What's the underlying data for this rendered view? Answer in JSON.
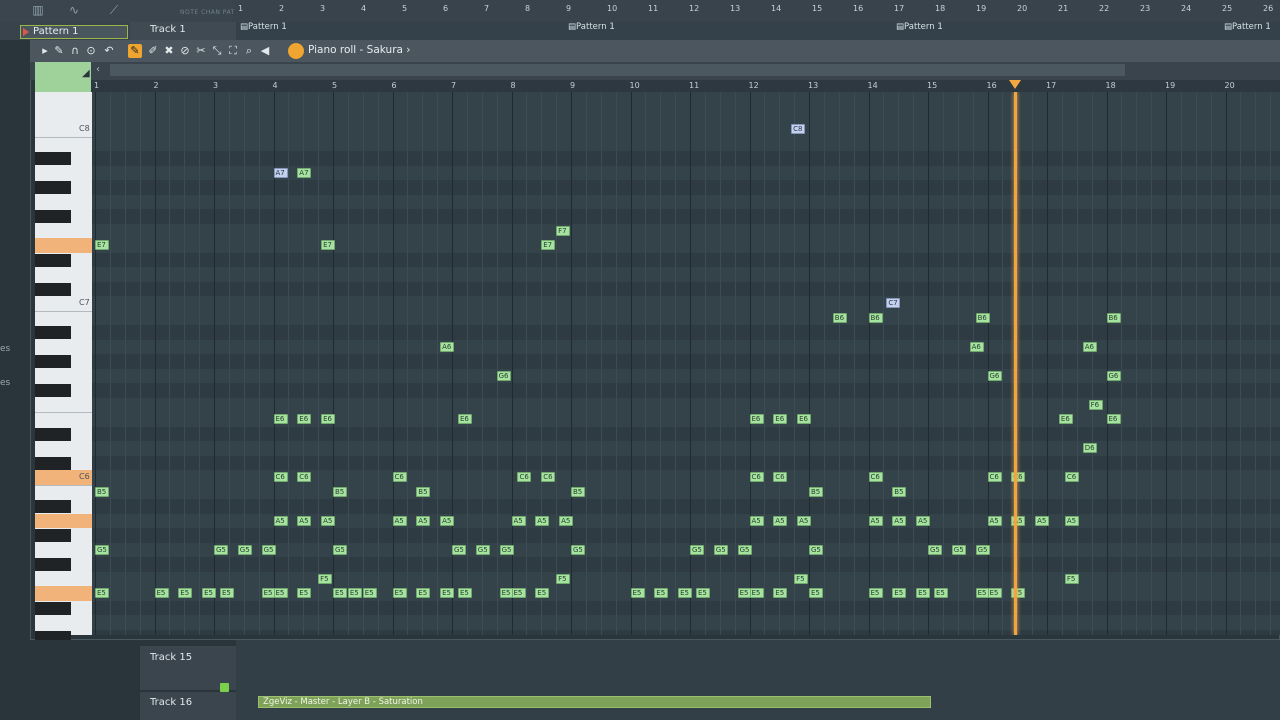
{
  "playlist": {
    "pattern_selector": "Pattern 1",
    "track1_name": "Track 1",
    "snap_label": "NOTE CHAN PAT",
    "ruler": [
      "1",
      "2",
      "3",
      "4",
      "5",
      "6",
      "7",
      "8",
      "9",
      "10",
      "11",
      "12",
      "13",
      "14",
      "15",
      "16",
      "17",
      "18",
      "19",
      "20",
      "21",
      "22",
      "23",
      "24",
      "25",
      "26"
    ],
    "patterns": [
      "Pattern 1",
      "Pattern 1",
      "Pattern 1",
      "Pattern 1",
      "Pattern 1"
    ],
    "tracks_bottom": [
      {
        "name": "Track 15"
      },
      {
        "name": "Track 16"
      }
    ],
    "automation_clip": "ZgeViz - Master - Layer B - Saturation",
    "left_edge_labels": [
      "es",
      "es"
    ]
  },
  "piano_roll": {
    "title": "Piano roll - Sakura",
    "title_arrow": "›",
    "ruler": [
      "1",
      "2",
      "3",
      "4",
      "5",
      "6",
      "7",
      "8",
      "9",
      "10",
      "11",
      "12",
      "13",
      "14",
      "15",
      "16",
      "17",
      "18",
      "19",
      "20"
    ],
    "octave_labels": [
      "C8",
      "C7",
      "C6"
    ],
    "playhead_bar": 16.45,
    "notes": [
      {
        "label": "C8",
        "bar": 12.7,
        "sel": true
      },
      {
        "label": "A7",
        "bar": 4.0,
        "sel": true
      },
      {
        "label": "A7",
        "bar": 4.4,
        "sel": false
      },
      {
        "label": "E7",
        "bar": 1.0,
        "sel": false
      },
      {
        "label": "E7",
        "bar": 4.8,
        "sel": false
      },
      {
        "label": "E7",
        "bar": 8.5,
        "sel": false
      },
      {
        "label": "F7",
        "bar": 8.75,
        "sel": false
      },
      {
        "label": "C7",
        "bar": 14.3,
        "sel": true
      },
      {
        "label": "B6",
        "bar": 13.4,
        "sel": false
      },
      {
        "label": "B6",
        "bar": 14.0,
        "sel": false
      },
      {
        "label": "B6",
        "bar": 15.8,
        "sel": false
      },
      {
        "label": "B6",
        "bar": 18.0,
        "sel": false
      },
      {
        "label": "A6",
        "bar": 6.8,
        "sel": false
      },
      {
        "label": "A6",
        "bar": 15.7,
        "sel": false
      },
      {
        "label": "A6",
        "bar": 17.6,
        "sel": false
      },
      {
        "label": "G6",
        "bar": 7.75,
        "sel": false
      },
      {
        "label": "G6",
        "bar": 16.0,
        "sel": false
      },
      {
        "label": "G6",
        "bar": 18.0,
        "sel": false
      },
      {
        "label": "F6",
        "bar": 17.7,
        "sel": false
      },
      {
        "label": "E6",
        "bar": 4.0,
        "sel": false
      },
      {
        "label": "E6",
        "bar": 4.4,
        "sel": false
      },
      {
        "label": "E6",
        "bar": 4.8,
        "sel": false
      },
      {
        "label": "E6",
        "bar": 7.1,
        "sel": false
      },
      {
        "label": "E6",
        "bar": 12.0,
        "sel": false
      },
      {
        "label": "E6",
        "bar": 12.4,
        "sel": false
      },
      {
        "label": "E6",
        "bar": 12.8,
        "sel": false
      },
      {
        "label": "E6",
        "bar": 17.2,
        "sel": false
      },
      {
        "label": "E6",
        "bar": 18.0,
        "sel": false
      },
      {
        "label": "D6",
        "bar": 17.6,
        "sel": false
      },
      {
        "label": "C6",
        "bar": 4.0,
        "sel": false
      },
      {
        "label": "C6",
        "bar": 4.4,
        "sel": false
      },
      {
        "label": "C6",
        "bar": 6.0,
        "sel": false
      },
      {
        "label": "C6",
        "bar": 8.1,
        "sel": false
      },
      {
        "label": "C6",
        "bar": 8.5,
        "sel": false
      },
      {
        "label": "C6",
        "bar": 12.0,
        "sel": false
      },
      {
        "label": "C6",
        "bar": 12.4,
        "sel": false
      },
      {
        "label": "C6",
        "bar": 14.0,
        "sel": false
      },
      {
        "label": "C6",
        "bar": 16.0,
        "sel": false
      },
      {
        "label": "C6",
        "bar": 16.4,
        "sel": false
      },
      {
        "label": "C6",
        "bar": 17.3,
        "sel": false
      },
      {
        "label": "B5",
        "bar": 1.0,
        "sel": false
      },
      {
        "label": "B5",
        "bar": 5.0,
        "sel": false
      },
      {
        "label": "B5",
        "bar": 6.4,
        "sel": false
      },
      {
        "label": "B5",
        "bar": 9.0,
        "sel": false
      },
      {
        "label": "B5",
        "bar": 13.0,
        "sel": false
      },
      {
        "label": "B5",
        "bar": 14.4,
        "sel": false
      },
      {
        "label": "A5",
        "bar": 4.0,
        "sel": false
      },
      {
        "label": "A5",
        "bar": 4.4,
        "sel": false
      },
      {
        "label": "A5",
        "bar": 4.8,
        "sel": false
      },
      {
        "label": "A5",
        "bar": 6.0,
        "sel": false
      },
      {
        "label": "A5",
        "bar": 6.4,
        "sel": false
      },
      {
        "label": "A5",
        "bar": 6.8,
        "sel": false
      },
      {
        "label": "A5",
        "bar": 8.0,
        "sel": false
      },
      {
        "label": "A5",
        "bar": 8.4,
        "sel": false
      },
      {
        "label": "A5",
        "bar": 8.8,
        "sel": false
      },
      {
        "label": "A5",
        "bar": 12.0,
        "sel": false
      },
      {
        "label": "A5",
        "bar": 12.4,
        "sel": false
      },
      {
        "label": "A5",
        "bar": 12.8,
        "sel": false
      },
      {
        "label": "A5",
        "bar": 14.0,
        "sel": false
      },
      {
        "label": "A5",
        "bar": 14.4,
        "sel": false
      },
      {
        "label": "A5",
        "bar": 14.8,
        "sel": false
      },
      {
        "label": "A5",
        "bar": 16.0,
        "sel": false
      },
      {
        "label": "A5",
        "bar": 16.4,
        "sel": false
      },
      {
        "label": "A5",
        "bar": 16.8,
        "sel": false
      },
      {
        "label": "A5",
        "bar": 17.3,
        "sel": false
      },
      {
        "label": "G5",
        "bar": 1.0,
        "sel": false
      },
      {
        "label": "G5",
        "bar": 3.0,
        "sel": false
      },
      {
        "label": "G5",
        "bar": 3.4,
        "sel": false
      },
      {
        "label": "G5",
        "bar": 3.8,
        "sel": false
      },
      {
        "label": "G5",
        "bar": 5.0,
        "sel": false
      },
      {
        "label": "G5",
        "bar": 7.0,
        "sel": false
      },
      {
        "label": "G5",
        "bar": 7.4,
        "sel": false
      },
      {
        "label": "G5",
        "bar": 7.8,
        "sel": false
      },
      {
        "label": "G5",
        "bar": 9.0,
        "sel": false
      },
      {
        "label": "G5",
        "bar": 11.0,
        "sel": false
      },
      {
        "label": "G5",
        "bar": 11.4,
        "sel": false
      },
      {
        "label": "G5",
        "bar": 11.8,
        "sel": false
      },
      {
        "label": "G5",
        "bar": 13.0,
        "sel": false
      },
      {
        "label": "G5",
        "bar": 15.0,
        "sel": false
      },
      {
        "label": "G5",
        "bar": 15.4,
        "sel": false
      },
      {
        "label": "G5",
        "bar": 15.8,
        "sel": false
      },
      {
        "label": "F5",
        "bar": 4.75,
        "sel": false
      },
      {
        "label": "F5",
        "bar": 8.75,
        "sel": false
      },
      {
        "label": "F5",
        "bar": 12.75,
        "sel": false
      },
      {
        "label": "F5",
        "bar": 17.3,
        "sel": false
      },
      {
        "label": "E5",
        "bar": 1.0,
        "sel": false
      },
      {
        "label": "E5",
        "bar": 2.0,
        "sel": false
      },
      {
        "label": "E5",
        "bar": 2.4,
        "sel": false
      },
      {
        "label": "E5",
        "bar": 2.8,
        "sel": false
      },
      {
        "label": "E5",
        "bar": 3.1,
        "sel": false
      },
      {
        "label": "E5",
        "bar": 3.8,
        "sel": false
      },
      {
        "label": "E5",
        "bar": 4.0,
        "sel": false
      },
      {
        "label": "E5",
        "bar": 4.4,
        "sel": false
      },
      {
        "label": "E5",
        "bar": 5.0,
        "sel": false
      },
      {
        "label": "E5",
        "bar": 5.25,
        "sel": false
      },
      {
        "label": "E5",
        "bar": 5.5,
        "sel": false
      },
      {
        "label": "E5",
        "bar": 6.0,
        "sel": false
      },
      {
        "label": "E5",
        "bar": 6.4,
        "sel": false
      },
      {
        "label": "E5",
        "bar": 6.8,
        "sel": false
      },
      {
        "label": "E5",
        "bar": 7.1,
        "sel": false
      },
      {
        "label": "E5",
        "bar": 7.8,
        "sel": false
      },
      {
        "label": "E5",
        "bar": 8.0,
        "sel": false
      },
      {
        "label": "E5",
        "bar": 8.4,
        "sel": false
      },
      {
        "label": "E5",
        "bar": 10.0,
        "sel": false
      },
      {
        "label": "E5",
        "bar": 10.4,
        "sel": false
      },
      {
        "label": "E5",
        "bar": 10.8,
        "sel": false
      },
      {
        "label": "E5",
        "bar": 11.1,
        "sel": false
      },
      {
        "label": "E5",
        "bar": 11.8,
        "sel": false
      },
      {
        "label": "E5",
        "bar": 12.0,
        "sel": false
      },
      {
        "label": "E5",
        "bar": 12.4,
        "sel": false
      },
      {
        "label": "E5",
        "bar": 13.0,
        "sel": false
      },
      {
        "label": "E5",
        "bar": 14.0,
        "sel": false
      },
      {
        "label": "E5",
        "bar": 14.4,
        "sel": false
      },
      {
        "label": "E5",
        "bar": 14.8,
        "sel": false
      },
      {
        "label": "E5",
        "bar": 15.1,
        "sel": false
      },
      {
        "label": "E5",
        "bar": 15.8,
        "sel": false
      },
      {
        "label": "E5",
        "bar": 16.0,
        "sel": false
      },
      {
        "label": "E5",
        "bar": 16.4,
        "sel": false
      }
    ]
  }
}
